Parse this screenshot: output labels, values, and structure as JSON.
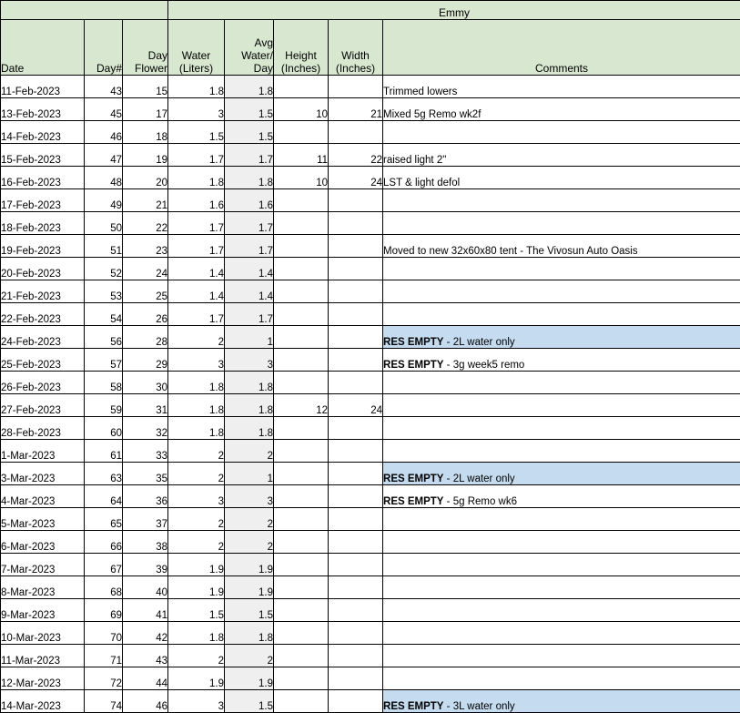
{
  "banner": {
    "title": "Emmy"
  },
  "colors": {
    "header_green": "#d8e8d0",
    "highlight_blue": "#c5dcf0",
    "avg_column_gray": "#efefef",
    "grid_black": "#000000"
  },
  "columns": {
    "date": "Date",
    "day_number": "Day#",
    "day_flower": "Day\nFlower",
    "day_flower_line1": "Day",
    "day_flower_line2": "Flower",
    "water_line1": "Water",
    "water_line2": "(Liters)",
    "avg_water_line1": "Avg",
    "avg_water_line2": "Water/",
    "avg_water_line3": "Day",
    "height_line1": "Height",
    "height_line2": "(Inches)",
    "width_line1": "Width",
    "width_line2": "(Inches)",
    "comments": "Comments"
  },
  "rows": [
    {
      "date": "11-Feb-2023",
      "day": "43",
      "flower": "15",
      "water": "1.8",
      "avg": "1.8",
      "height": "",
      "width": "",
      "res": "",
      "comment": "Trimmed lowers",
      "highlight": false
    },
    {
      "date": "13-Feb-2023",
      "day": "45",
      "flower": "17",
      "water": "3",
      "avg": "1.5",
      "height": "10",
      "width": "21",
      "res": "",
      "comment": "Mixed 5g Remo wk2f",
      "highlight": false
    },
    {
      "date": "14-Feb-2023",
      "day": "46",
      "flower": "18",
      "water": "1.5",
      "avg": "1.5",
      "height": "",
      "width": "",
      "res": "",
      "comment": "",
      "highlight": false
    },
    {
      "date": "15-Feb-2023",
      "day": "47",
      "flower": "19",
      "water": "1.7",
      "avg": "1.7",
      "height": "11",
      "width": "22",
      "res": "",
      "comment": "raised light 2\"",
      "highlight": false
    },
    {
      "date": "16-Feb-2023",
      "day": "48",
      "flower": "20",
      "water": "1.8",
      "avg": "1.8",
      "height": "10",
      "width": "24",
      "res": "",
      "comment": "LST & light defol",
      "highlight": false
    },
    {
      "date": "17-Feb-2023",
      "day": "49",
      "flower": "21",
      "water": "1.6",
      "avg": "1.6",
      "height": "",
      "width": "",
      "res": "",
      "comment": "",
      "highlight": false
    },
    {
      "date": "18-Feb-2023",
      "day": "50",
      "flower": "22",
      "water": "1.7",
      "avg": "1.7",
      "height": "",
      "width": "",
      "res": "",
      "comment": "",
      "highlight": false
    },
    {
      "date": "19-Feb-2023",
      "day": "51",
      "flower": "23",
      "water": "1.7",
      "avg": "1.7",
      "height": "",
      "width": "",
      "res": "",
      "comment": "Moved to new 32x60x80 tent - The Vivosun Auto Oasis",
      "highlight": false
    },
    {
      "date": "20-Feb-2023",
      "day": "52",
      "flower": "24",
      "water": "1.4",
      "avg": "1.4",
      "height": "",
      "width": "",
      "res": "",
      "comment": "",
      "highlight": false
    },
    {
      "date": "21-Feb-2023",
      "day": "53",
      "flower": "25",
      "water": "1.4",
      "avg": "1.4",
      "height": "",
      "width": "",
      "res": "",
      "comment": "",
      "highlight": false
    },
    {
      "date": "22-Feb-2023",
      "day": "54",
      "flower": "26",
      "water": "1.7",
      "avg": "1.7",
      "height": "",
      "width": "",
      "res": "",
      "comment": "",
      "highlight": false
    },
    {
      "date": "24-Feb-2023",
      "day": "56",
      "flower": "28",
      "water": "2",
      "avg": "1",
      "height": "",
      "width": "",
      "res": "RES EMPTY",
      "comment": " - 2L water only",
      "highlight": true
    },
    {
      "date": "25-Feb-2023",
      "day": "57",
      "flower": "29",
      "water": "3",
      "avg": "3",
      "height": "",
      "width": "",
      "res": "RES EMPTY",
      "comment": " - 3g week5 remo",
      "highlight": false
    },
    {
      "date": "26-Feb-2023",
      "day": "58",
      "flower": "30",
      "water": "1.8",
      "avg": "1.8",
      "height": "",
      "width": "",
      "res": "",
      "comment": "",
      "highlight": false
    },
    {
      "date": "27-Feb-2023",
      "day": "59",
      "flower": "31",
      "water": "1.8",
      "avg": "1.8",
      "height": "12",
      "width": "24",
      "res": "",
      "comment": "",
      "highlight": false
    },
    {
      "date": "28-Feb-2023",
      "day": "60",
      "flower": "32",
      "water": "1.8",
      "avg": "1.8",
      "height": "",
      "width": "",
      "res": "",
      "comment": "",
      "highlight": false
    },
    {
      "date": "1-Mar-2023",
      "day": "61",
      "flower": "33",
      "water": "2",
      "avg": "2",
      "height": "",
      "width": "",
      "res": "",
      "comment": "",
      "highlight": false
    },
    {
      "date": "3-Mar-2023",
      "day": "63",
      "flower": "35",
      "water": "2",
      "avg": "1",
      "height": "",
      "width": "",
      "res": "RES EMPTY",
      "comment": " - 2L water only",
      "highlight": true
    },
    {
      "date": "4-Mar-2023",
      "day": "64",
      "flower": "36",
      "water": "3",
      "avg": "3",
      "height": "",
      "width": "",
      "res": "RES EMPTY",
      "comment": " - 5g Remo wk6",
      "highlight": false
    },
    {
      "date": "5-Mar-2023",
      "day": "65",
      "flower": "37",
      "water": "2",
      "avg": "2",
      "height": "",
      "width": "",
      "res": "",
      "comment": "",
      "highlight": false
    },
    {
      "date": "6-Mar-2023",
      "day": "66",
      "flower": "38",
      "water": "2",
      "avg": "2",
      "height": "",
      "width": "",
      "res": "",
      "comment": "",
      "highlight": false
    },
    {
      "date": "7-Mar-2023",
      "day": "67",
      "flower": "39",
      "water": "1.9",
      "avg": "1.9",
      "height": "",
      "width": "",
      "res": "",
      "comment": "",
      "highlight": false
    },
    {
      "date": "8-Mar-2023",
      "day": "68",
      "flower": "40",
      "water": "1.9",
      "avg": "1.9",
      "height": "",
      "width": "",
      "res": "",
      "comment": "",
      "highlight": false
    },
    {
      "date": "9-Mar-2023",
      "day": "69",
      "flower": "41",
      "water": "1.5",
      "avg": "1.5",
      "height": "",
      "width": "",
      "res": "",
      "comment": "",
      "highlight": false
    },
    {
      "date": "10-Mar-2023",
      "day": "70",
      "flower": "42",
      "water": "1.8",
      "avg": "1.8",
      "height": "",
      "width": "",
      "res": "",
      "comment": "",
      "highlight": false
    },
    {
      "date": "11-Mar-2023",
      "day": "71",
      "flower": "43",
      "water": "2",
      "avg": "2",
      "height": "",
      "width": "",
      "res": "",
      "comment": "",
      "highlight": false
    },
    {
      "date": "12-Mar-2023",
      "day": "72",
      "flower": "44",
      "water": "1.9",
      "avg": "1.9",
      "height": "",
      "width": "",
      "res": "",
      "comment": "",
      "highlight": false
    },
    {
      "date": "14-Mar-2023",
      "day": "74",
      "flower": "46",
      "water": "3",
      "avg": "1.5",
      "height": "",
      "width": "",
      "res": "RES EMPTY",
      "comment": " - 3L water only",
      "highlight": true
    }
  ]
}
